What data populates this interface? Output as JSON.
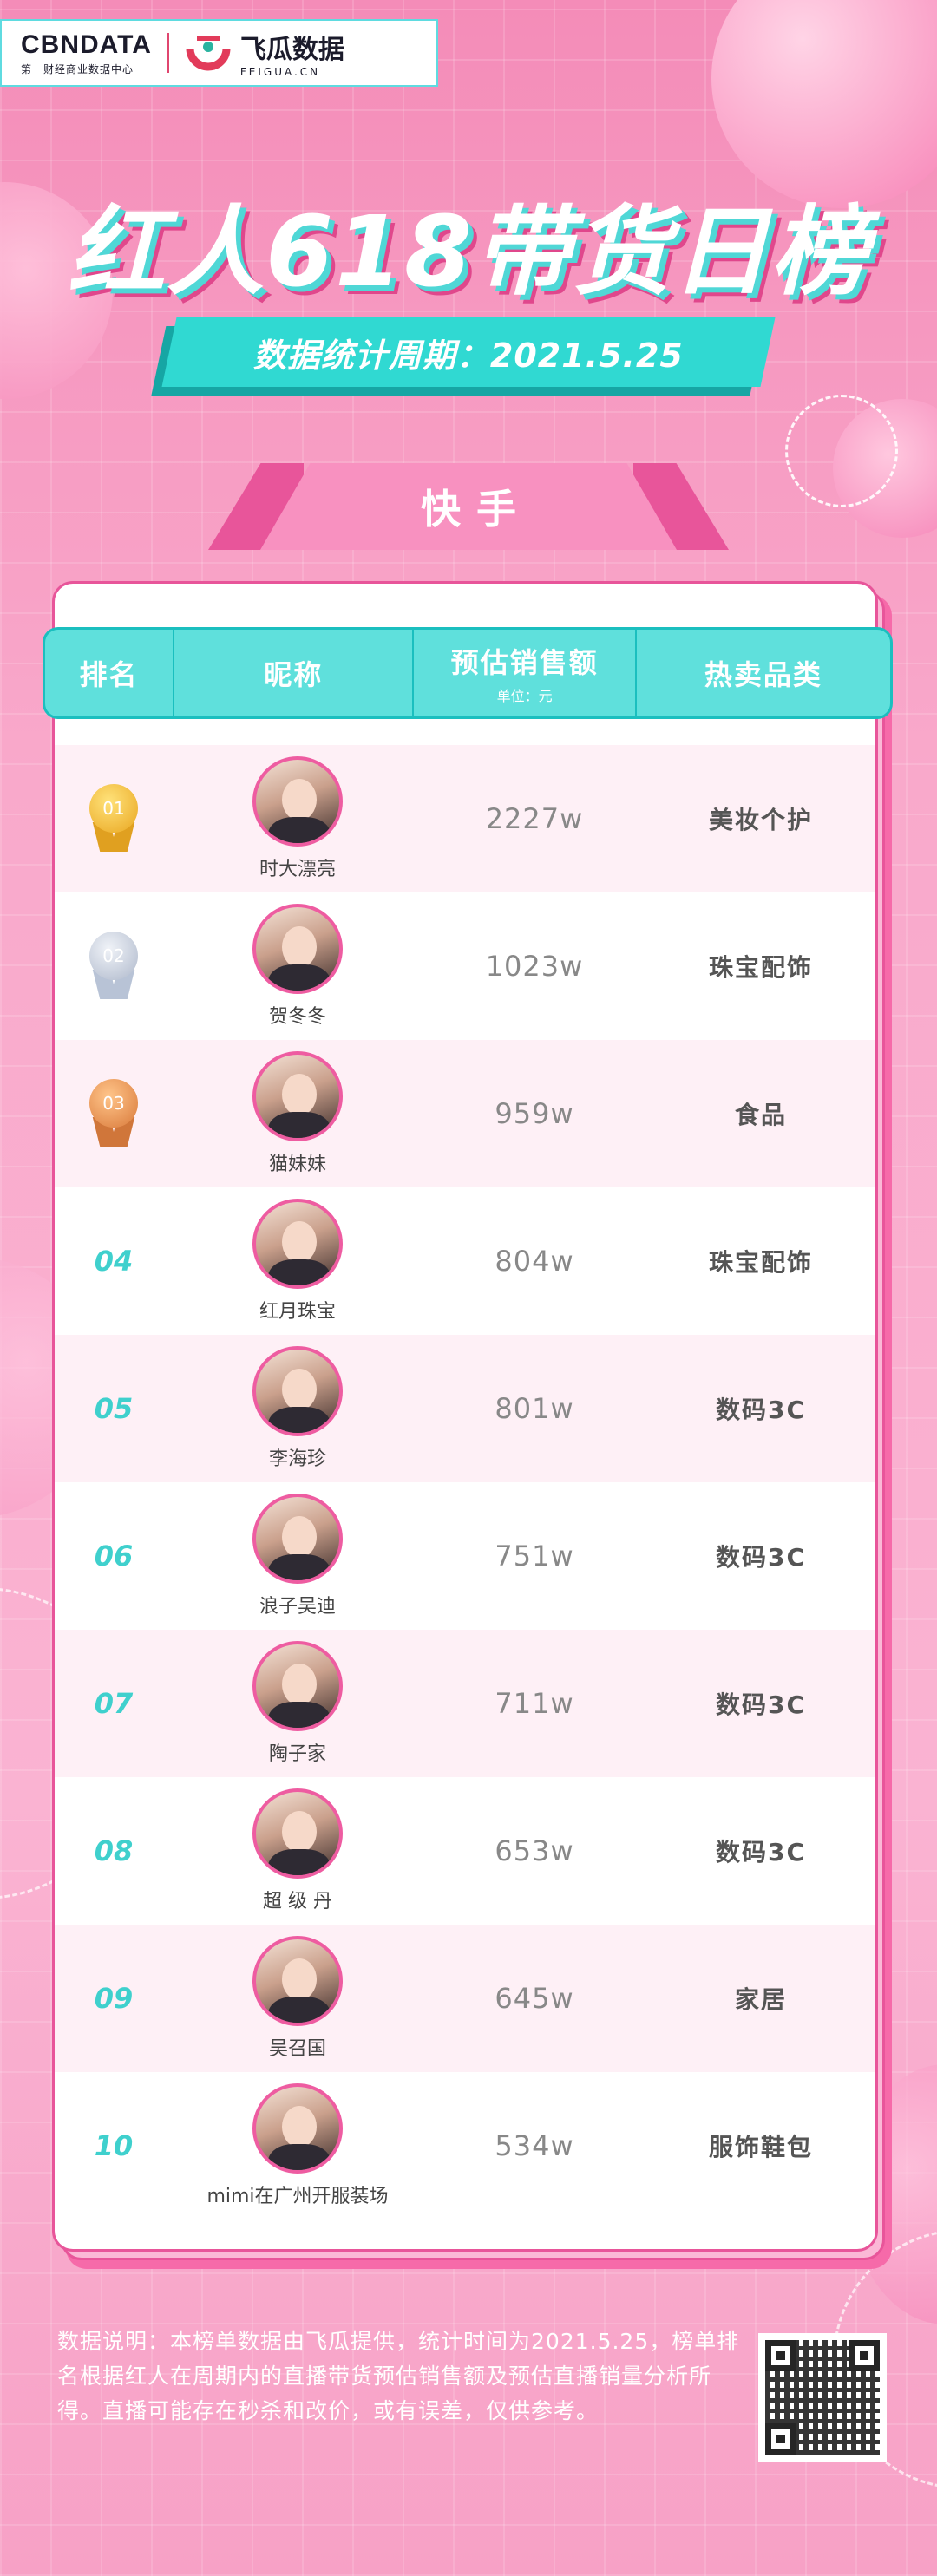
{
  "header": {
    "cbn_name": "CBNDATA",
    "cbn_subtitle": "第一财经商业数据中心",
    "feigua_name": "飞瓜数据",
    "feigua_subtitle": "FEIGUA.CN"
  },
  "title": "红人618带货日榜",
  "period": "数据统计周期：2021.5.25",
  "platform_tab": "快手",
  "table": {
    "headers": {
      "rank": "排名",
      "nickname": "昵称",
      "sales": "预估销售额",
      "sales_unit": "单位：元",
      "category": "热卖品类"
    },
    "rows": [
      {
        "rank": "01",
        "nickname": "时大漂亮",
        "sales": "2227w",
        "category": "美妆个护"
      },
      {
        "rank": "02",
        "nickname": "贺冬冬",
        "sales": "1023w",
        "category": "珠宝配饰"
      },
      {
        "rank": "03",
        "nickname": "猫妹妹",
        "sales": "959w",
        "category": "食品"
      },
      {
        "rank": "04",
        "nickname": "红月珠宝",
        "sales": "804w",
        "category": "珠宝配饰"
      },
      {
        "rank": "05",
        "nickname": "李海珍",
        "sales": "801w",
        "category": "数码3C"
      },
      {
        "rank": "06",
        "nickname": "浪子吴迪",
        "sales": "751w",
        "category": "数码3C"
      },
      {
        "rank": "07",
        "nickname": "陶子家",
        "sales": "711w",
        "category": "数码3C"
      },
      {
        "rank": "08",
        "nickname": "超 级 丹",
        "sales": "653w",
        "category": "数码3C"
      },
      {
        "rank": "09",
        "nickname": "吴召国",
        "sales": "645w",
        "category": "家居"
      },
      {
        "rank": "10",
        "nickname": "mimi在广州开服装场",
        "sales": "534w",
        "category": "服饰鞋包"
      }
    ]
  },
  "footnote": "数据说明：本榜单数据由飞瓜提供，统计时间为2021.5.25，榜单排名根据红人在周期内的直播带货预估销售额及预估直播销量分析所得。直播可能存在秒杀和改价，或有误差，仅供参考。",
  "colors": {
    "accent_pink": "#e8559a",
    "accent_teal": "#5fe0dc",
    "rank_teal": "#3fd0cd"
  }
}
